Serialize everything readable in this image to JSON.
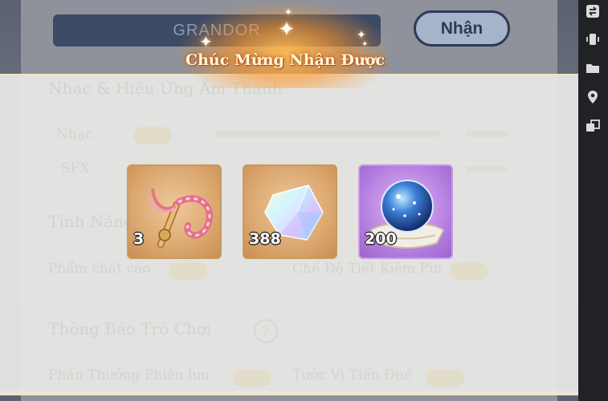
{
  "settings": {
    "code_input_value": "GRANDOR",
    "receive_button": "Nhận",
    "ghost": {
      "audio_section": "Nhạc & Hiệu Ứng Âm Thanh",
      "music": "Nhạc",
      "sfx": "SFX",
      "features_section": "Tính Năng",
      "high_quality": "Phẩm chất cao",
      "battery_saver": "Chế Độ Tiết Kiệm Pin",
      "notifications_section": "Thông Báo Trò Chơi",
      "help_mark": "?",
      "adventure_reward": "Phần Thưởng Phiêu lưu",
      "guild_war": "Tước Vị Tiền Đuế"
    }
  },
  "reward_popup": {
    "title": "Chúc Mừng Nhận Được",
    "items": [
      {
        "icon": "pink-staff-icon",
        "quantity": "3",
        "rarity_color": "#d9a56c"
      },
      {
        "icon": "rainbow-crystal-icon",
        "quantity": "388",
        "rarity_color": "#d9a56c"
      },
      {
        "icon": "crystal-orb-icon",
        "quantity": "200",
        "rarity_color": "#b47ee0"
      }
    ]
  },
  "sidebar": {
    "icons": [
      "swap-icon",
      "phone-vibrate-icon",
      "folder-icon",
      "location-pin-icon",
      "windows-icon"
    ]
  }
}
